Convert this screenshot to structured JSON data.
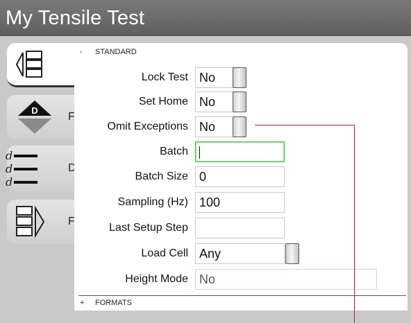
{
  "window": {
    "title": "My Tensile Test"
  },
  "tabs": [
    {
      "id": "setup",
      "label": "",
      "icon": "setup-panels-icon"
    },
    {
      "id": "delta",
      "label": "F",
      "icon": "delta-diamond-icon"
    },
    {
      "id": "data",
      "label": "D",
      "icon": "data-lines-icon"
    },
    {
      "id": "results",
      "label": "F",
      "icon": "results-panels-icon"
    }
  ],
  "sections": {
    "standard": {
      "sign": "-",
      "label": "STANDARD"
    },
    "formats": {
      "sign": "+",
      "label": "FORMATS"
    }
  },
  "fields": {
    "lock_test": {
      "label": "Lock Test",
      "value": "No"
    },
    "set_home": {
      "label": "Set Home",
      "value": "No"
    },
    "omit_exceptions": {
      "label": "Omit Exceptions",
      "value": "No"
    },
    "batch": {
      "label": "Batch",
      "value": ""
    },
    "batch_size": {
      "label": "Batch Size",
      "value": "0"
    },
    "sampling": {
      "label": "Sampling (Hz)",
      "value": "100"
    },
    "last_setup_step": {
      "label": "Last Setup Step",
      "value": ""
    },
    "load_cell": {
      "label": "Load Cell",
      "value": "Any"
    },
    "height_mode": {
      "label": "Height Mode",
      "value": "No"
    }
  },
  "colors": {
    "title_bar": "#6b6b6b",
    "focus_border": "#41c441",
    "leader_line": "#c4151c"
  }
}
